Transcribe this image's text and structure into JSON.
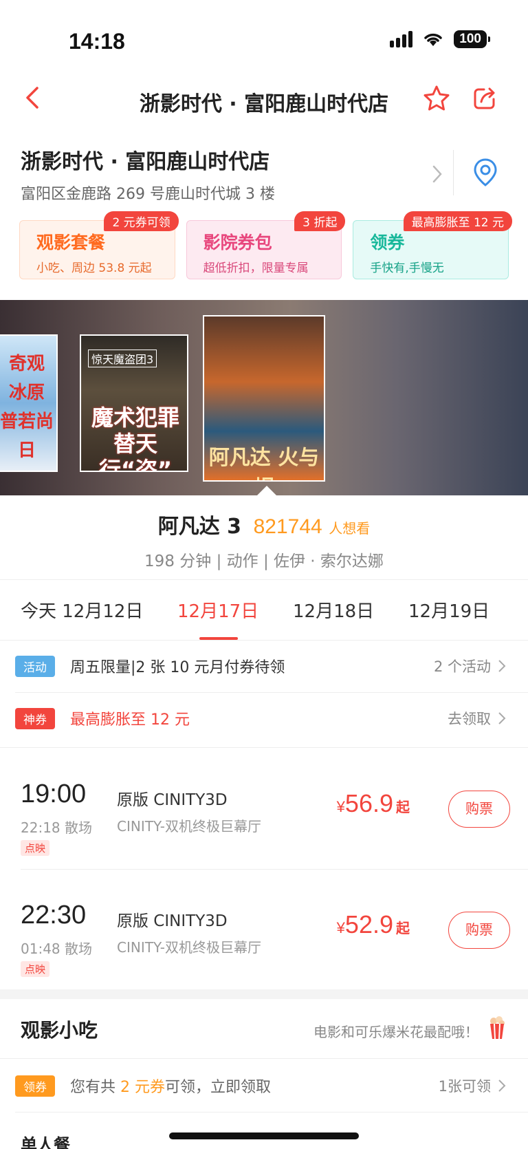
{
  "status_bar": {
    "time": "14:18",
    "battery": "100"
  },
  "nav": {
    "title": "浙影时代 · 富阳鹿山时代店"
  },
  "cinema": {
    "name": "浙影时代 · 富阳鹿山时代店",
    "address": "富阳区金鹿路 269 号鹿山时代城 3 楼"
  },
  "promos": [
    {
      "title": "观影套餐",
      "subtitle": "小吃、周边 53.8 元起",
      "tag": "2 元券可领"
    },
    {
      "title": "影院券包",
      "subtitle": "超低折扣，限量专属",
      "tag": "3 折起"
    },
    {
      "title": "领券",
      "subtitle": "手快有,手慢无",
      "tag": "最高膨胀至 12 元"
    }
  ],
  "posters": [
    {
      "text": "奇观 冰原 普若尚日"
    },
    {
      "tag": "惊天魔盗团3",
      "text": "魔术犯罪 替天行“盗”"
    },
    {
      "text": "阿凡达 火与烬"
    }
  ],
  "movie": {
    "title": "阿凡达 3",
    "want_count": "821744",
    "want_label": "人想看",
    "meta": "198 分钟 | 动作 | 佐伊 · 索尔达娜"
  },
  "dates": [
    {
      "label": "今天 12月12日"
    },
    {
      "label": "12月17日"
    },
    {
      "label": "12月18日"
    },
    {
      "label": "12月19日"
    }
  ],
  "activity": {
    "badge": "活动",
    "text": "周五限量|2 张 10 元月付券待领",
    "right": "2 个活动"
  },
  "super_coupon": {
    "badge": "神券",
    "text": "最高膨胀至 12 元",
    "right": "去领取"
  },
  "showtimes": [
    {
      "time": "19:00",
      "end": "22:18 散场",
      "tag": "点映",
      "version": "原版 CINITY3D",
      "hall": "CINITY-双机终极巨幕厅",
      "currency": "¥",
      "price": "56.9",
      "suffix": "起",
      "button": "购票"
    },
    {
      "time": "22:30",
      "end": "01:48 散场",
      "tag": "点映",
      "version": "原版 CINITY3D",
      "hall": "CINITY-双机终极巨幕厅",
      "currency": "¥",
      "price": "52.9",
      "suffix": "起",
      "button": "购票"
    }
  ],
  "snacks": {
    "title": "观影小吃",
    "slogan": "电影和可乐爆米花最配哦！",
    "coupon_badge": "领券",
    "coupon_text_before": "您有共 ",
    "coupon_text_highlight": "2 元券",
    "coupon_text_after": "可领，立即领取",
    "coupon_right": "1张可领",
    "section_label": "单人餐"
  },
  "colors": {
    "accent": "#f2453d",
    "orange": "#ff9a1f",
    "activity_badge": "#5aaee8",
    "super_badge": "#f2453d"
  }
}
